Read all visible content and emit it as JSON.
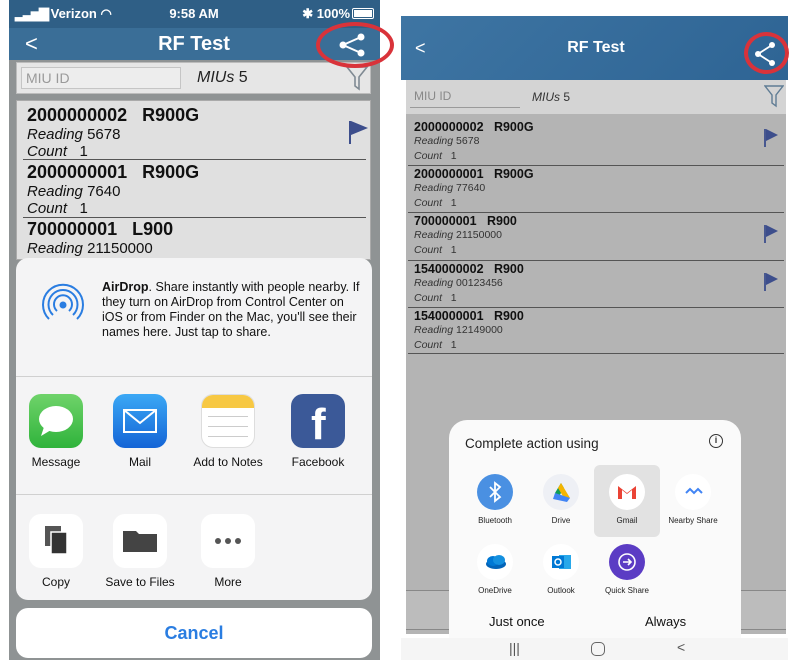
{
  "ios": {
    "status": {
      "carrier": "Verizon",
      "time": "9:58 AM",
      "battery": "100%"
    },
    "nav": {
      "back": "<",
      "title": "RF Test"
    },
    "search": {
      "placeholder": "MIU ID",
      "mius_label": "MIUs",
      "mius_count": "5"
    },
    "items": [
      {
        "id": "2000000002",
        "model": "R900G",
        "reading_label": "Reading",
        "reading": "5678",
        "count_label": "Count",
        "count": "1"
      },
      {
        "id": "2000000001",
        "model": "R900G",
        "reading_label": "Reading",
        "reading": "7640",
        "count_label": "Count",
        "count": "1"
      },
      {
        "id": "700000001",
        "model": "L900",
        "reading_label": "Reading",
        "reading": "21150000"
      }
    ],
    "airdrop": {
      "title": "AirDrop",
      "text": ". Share instantly with people nearby. If they turn on AirDrop from Control Center on iOS or from Finder on the Mac, you'll see their names here. Just tap to share."
    },
    "apps": [
      "Message",
      "Mail",
      "Add to Notes",
      "Facebook"
    ],
    "actions": [
      "Copy",
      "Save to Files",
      "More"
    ],
    "cancel": "Cancel"
  },
  "android": {
    "nav": {
      "back": "<",
      "title": "RF Test"
    },
    "search": {
      "placeholder": "MIU ID",
      "mius_label": "MIUs",
      "mius_count": "5"
    },
    "items": [
      {
        "id": "2000000002",
        "model": "R900G",
        "reading_label": "Reading",
        "reading": "5678",
        "count_label": "Count",
        "count": "1"
      },
      {
        "id": "2000000001",
        "model": "R900G",
        "reading_label": "Reading",
        "reading": "77640",
        "count_label": "Count",
        "count": "1"
      },
      {
        "id": "700000001",
        "model": "R900",
        "reading_label": "Reading",
        "reading": "21150000",
        "count_label": "Count",
        "count": "1"
      },
      {
        "id": "1540000002",
        "model": "R900",
        "reading_label": "Reading",
        "reading": "00123456",
        "count_label": "Count",
        "count": "1"
      },
      {
        "id": "1540000001",
        "model": "R900",
        "reading_label": "Reading",
        "reading": "12149000",
        "count_label": "Count",
        "count": "1"
      }
    ],
    "sheet": {
      "title": "Complete action using",
      "info": "i",
      "apps": [
        "Bluetooth",
        "Drive",
        "Gmail",
        "Nearby Share",
        "OneDrive",
        "Outlook",
        "Quick Share"
      ],
      "just_once": "Just once",
      "always": "Always"
    },
    "sysnav": {
      "recents": "|||",
      "back": "<"
    }
  },
  "colors": {
    "ios_nav": "#3a6e97",
    "android_header": "#3e75a3",
    "highlight_ring": "#d9333a",
    "flag": "#3d4e8c",
    "ios_link": "#2a7de1"
  }
}
